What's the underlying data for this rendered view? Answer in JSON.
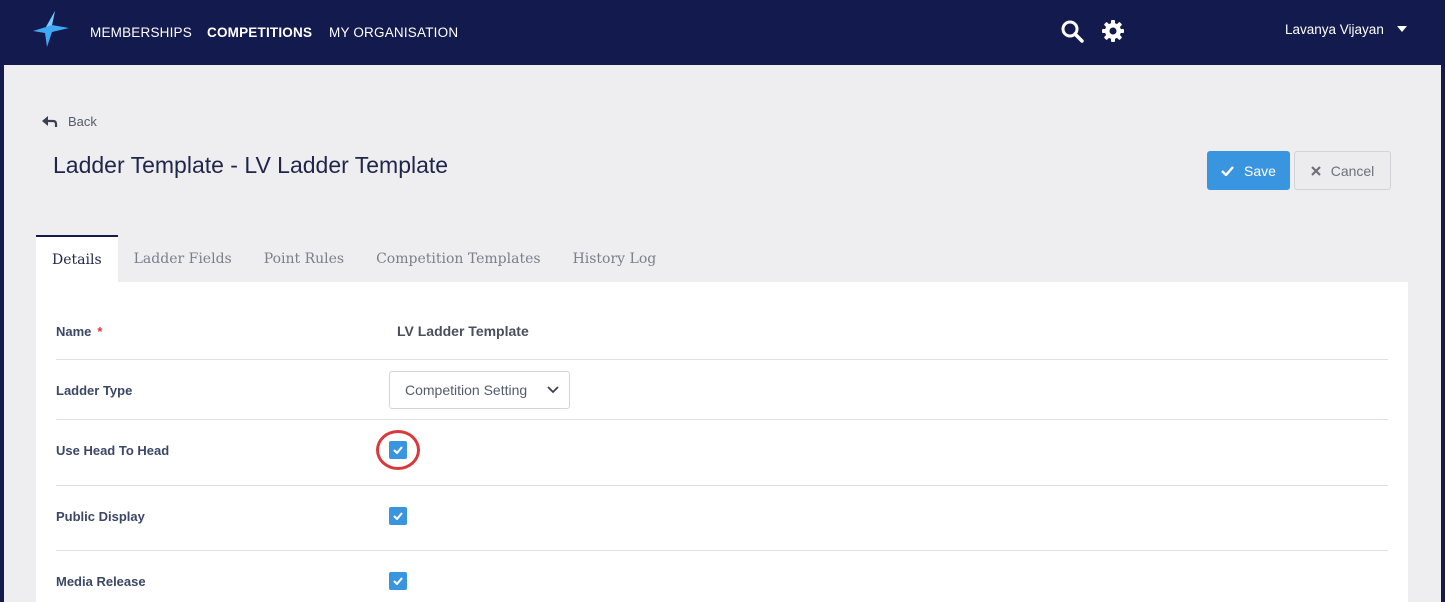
{
  "nav": {
    "items": [
      "MEMBERSHIPS",
      "COMPETITIONS",
      "MY ORGANISATION"
    ],
    "active": "COMPETITIONS",
    "user_name": "Lavanya Vijayan",
    "icons": [
      "search-icon",
      "gear-icon",
      "caret-down-icon"
    ]
  },
  "page": {
    "back_label": "Back",
    "title": "Ladder Template - LV Ladder Template",
    "save_label": "Save",
    "cancel_label": "Cancel"
  },
  "tabs": [
    "Details",
    "Ladder Fields",
    "Point Rules",
    "Competition Templates",
    "History Log"
  ],
  "active_tab": "Details",
  "form": {
    "name_label": "Name",
    "required_mark": "*",
    "name_value": "LV Ladder Template",
    "ladder_type_label": "Ladder Type",
    "ladder_type_value": "Competition Setting",
    "head_to_head_label": "Use Head To Head",
    "head_to_head_checked": true,
    "public_display_label": "Public Display",
    "public_display_checked": true,
    "media_release_label": "Media Release",
    "media_release_checked": true
  },
  "colors": {
    "nav_bg": "#131a4d",
    "accent": "#3a95e0",
    "content_bg": "#eeeef1",
    "highlight": "#d8393d"
  }
}
